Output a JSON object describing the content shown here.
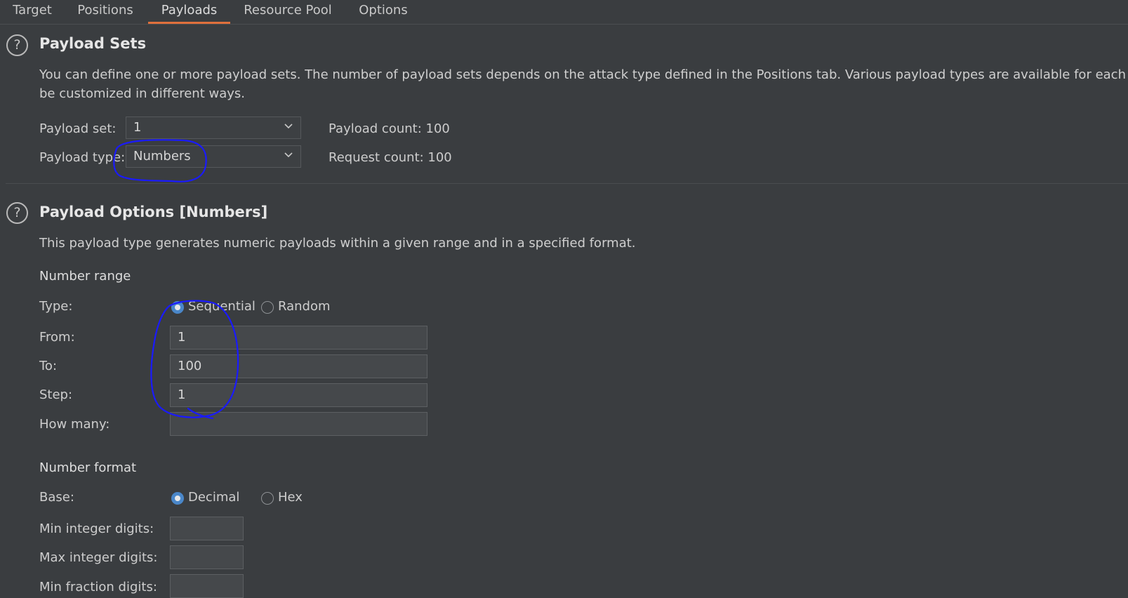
{
  "tabs": [
    {
      "label": "Target"
    },
    {
      "label": "Positions"
    },
    {
      "label": "Payloads",
      "active": true
    },
    {
      "label": "Resource Pool"
    },
    {
      "label": "Options"
    }
  ],
  "payload_sets": {
    "help": "?",
    "title": "Payload Sets",
    "description_line1": "You can define one or more payload sets. The number of payload sets depends on the attack type defined in the Positions tab. Various payload types are available for each payload set, and each payload type can",
    "description_line2": "be customized in different ways.",
    "set_label": "Payload set:",
    "set_value": "1",
    "type_label": "Payload type:",
    "type_value": "Numbers",
    "payload_count": "Payload count: 100",
    "request_count": "Request count: 100"
  },
  "payload_options": {
    "help": "?",
    "title": "Payload Options [Numbers]",
    "description": "This payload type generates numeric payloads within a given range and in a specified format.",
    "number_range": {
      "heading": "Number range",
      "type_label": "Type:",
      "type_options": [
        "Sequential",
        "Random"
      ],
      "type_selected": "Sequential",
      "from_label": "From:",
      "from_value": "1",
      "to_label": "To:",
      "to_value": "100",
      "step_label": "Step:",
      "step_value": "1",
      "how_many_label": "How many:",
      "how_many_value": ""
    },
    "number_format": {
      "heading": "Number format",
      "base_label": "Base:",
      "base_options": [
        "Decimal",
        "Hex"
      ],
      "base_selected": "Decimal",
      "min_int_label": "Min integer digits:",
      "min_int_value": "",
      "max_int_label": "Max integer digits:",
      "max_int_value": "",
      "min_frac_label": "Min fraction digits:",
      "min_frac_value": ""
    }
  },
  "colors": {
    "background": "#3a3d40",
    "active_tab_underline": "#e0703c",
    "radio_selected": "#4a87c9",
    "annotation_ink": "#1a1aff"
  },
  "icons": {
    "help": "help-circle-icon",
    "dropdown": "chevron-down-icon"
  }
}
